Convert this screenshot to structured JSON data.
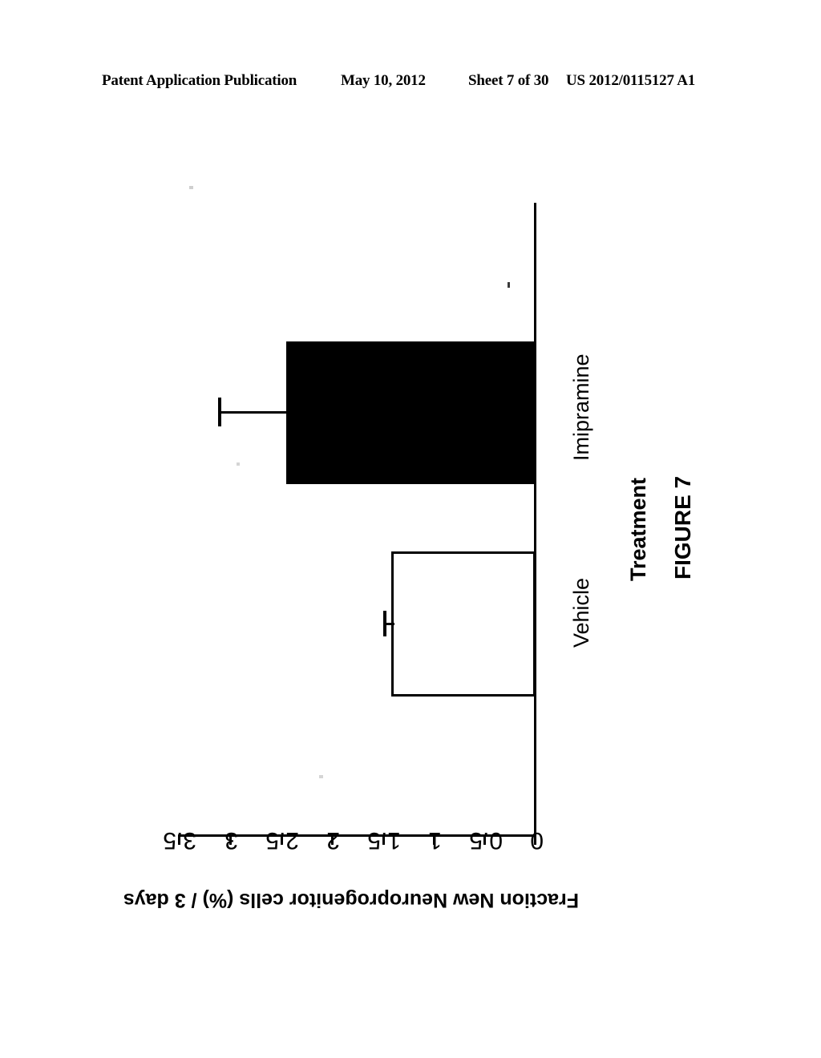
{
  "header": {
    "publication": "Patent Application Publication",
    "date": "May 10, 2012",
    "sheet": "Sheet 7 of 30",
    "number": "US 2012/0115127 A1"
  },
  "figure": {
    "caption": "FIGURE 7"
  },
  "chart_data": {
    "type": "bar",
    "orientation": "vertical-rendered-sideways",
    "title": "",
    "xlabel": "Treatment",
    "ylabel": "Fraction New Neuroprogenitor cells (%) / 3 days",
    "categories": [
      "Vehicle",
      "Imipramine"
    ],
    "values": [
      1.4,
      2.44
    ],
    "errors": [
      0.08,
      0.67
    ],
    "error_type": "upper",
    "series": [
      {
        "name": "Fraction New Neuroprogenitor cells (%) / 3 days",
        "values": [
          1.4,
          2.44
        ],
        "errors": [
          0.08,
          0.67
        ],
        "fills": [
          "open",
          "filled"
        ]
      }
    ],
    "ylim": [
      0,
      3.5
    ],
    "ytick_labels": [
      "3.5",
      "3",
      "2.5",
      "2",
      "1.5",
      "1",
      "0.5",
      "0"
    ],
    "ytick_values": [
      3.5,
      3,
      2.5,
      2,
      1.5,
      1,
      0.5,
      0
    ],
    "grid": false,
    "legend": false,
    "legend_position": "none"
  }
}
